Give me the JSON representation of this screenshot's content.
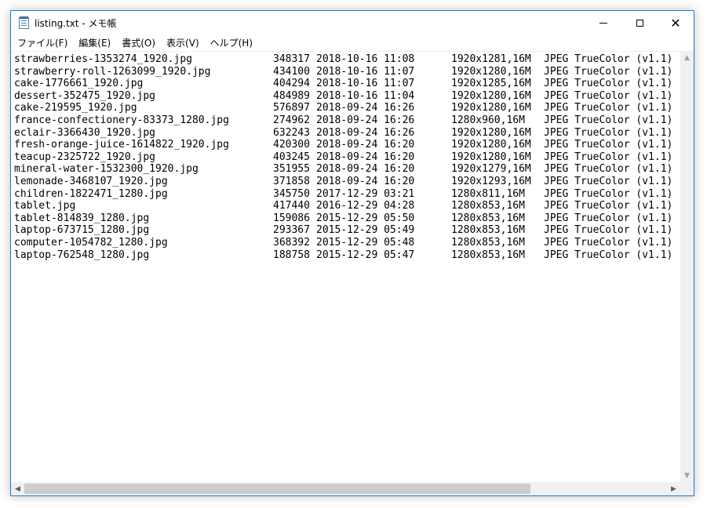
{
  "window": {
    "title": "listing.txt - メモ帳",
    "minimize_icon": "minimize-icon",
    "maximize_icon": "maximize-icon",
    "close_icon": "close-icon",
    "close_glyph": "✕"
  },
  "menu": [
    "ファイル(F)",
    "編集(E)",
    "書式(O)",
    "表示(V)",
    "ヘルプ(H)"
  ],
  "lines": [
    {
      "name": "strawberries-1353274_1920.jpg",
      "size": "348317",
      "date": "2018-10-16 11:08",
      "dim": "1920x1281,16M",
      "type": "JPEG TrueColor (v1.1)"
    },
    {
      "name": "strawberry-roll-1263099_1920.jpg",
      "size": "434100",
      "date": "2018-10-16 11:07",
      "dim": "1920x1280,16M",
      "type": "JPEG TrueColor (v1.1)"
    },
    {
      "name": "cake-1776661_1920.jpg",
      "size": "404294",
      "date": "2018-10-16 11:07",
      "dim": "1920x1285,16M",
      "type": "JPEG TrueColor (v1.1)"
    },
    {
      "name": "dessert-352475_1920.jpg",
      "size": "484989",
      "date": "2018-10-16 11:04",
      "dim": "1920x1280,16M",
      "type": "JPEG TrueColor (v1.1)"
    },
    {
      "name": "cake-219595_1920.jpg",
      "size": "576897",
      "date": "2018-09-24 16:26",
      "dim": "1920x1280,16M",
      "type": "JPEG TrueColor (v1.1)"
    },
    {
      "name": "france-confectionery-83373_1280.jpg",
      "size": "274962",
      "date": "2018-09-24 16:26",
      "dim": "1280x960,16M",
      "type": "JPEG TrueColor (v1.1)"
    },
    {
      "name": "eclair-3366430_1920.jpg",
      "size": "632243",
      "date": "2018-09-24 16:26",
      "dim": "1920x1280,16M",
      "type": "JPEG TrueColor (v1.1)"
    },
    {
      "name": "fresh-orange-juice-1614822_1920.jpg",
      "size": "420300",
      "date": "2018-09-24 16:20",
      "dim": "1920x1280,16M",
      "type": "JPEG TrueColor (v1.1)"
    },
    {
      "name": "teacup-2325722_1920.jpg",
      "size": "403245",
      "date": "2018-09-24 16:20",
      "dim": "1920x1280,16M",
      "type": "JPEG TrueColor (v1.1)"
    },
    {
      "name": "mineral-water-1532300_1920.jpg",
      "size": "351955",
      "date": "2018-09-24 16:20",
      "dim": "1920x1279,16M",
      "type": "JPEG TrueColor (v1.1)"
    },
    {
      "name": "lemonade-3468107_1920.jpg",
      "size": "371858",
      "date": "2018-09-24 16:20",
      "dim": "1920x1293,16M",
      "type": "JPEG TrueColor (v1.1)"
    },
    {
      "name": "children-1822471_1280.jpg",
      "size": "345750",
      "date": "2017-12-29 03:21",
      "dim": "1280x811,16M",
      "type": "JPEG TrueColor (v1.1)"
    },
    {
      "name": "tablet.jpg",
      "size": "417440",
      "date": "2016-12-29 04:28",
      "dim": "1280x853,16M",
      "type": "JPEG TrueColor (v1.1)"
    },
    {
      "name": "tablet-814839_1280.jpg",
      "size": "159086",
      "date": "2015-12-29 05:50",
      "dim": "1280x853,16M",
      "type": "JPEG TrueColor (v1.1)"
    },
    {
      "name": "laptop-673715_1280.jpg",
      "size": "293367",
      "date": "2015-12-29 05:49",
      "dim": "1280x853,16M",
      "type": "JPEG TrueColor (v1.1)"
    },
    {
      "name": "computer-1054782_1280.jpg",
      "size": "368392",
      "date": "2015-12-29 05:48",
      "dim": "1280x853,16M",
      "type": "JPEG TrueColor (v1.1)"
    },
    {
      "name": "laptop-762548_1280.jpg",
      "size": "188758",
      "date": "2015-12-29 05:47",
      "dim": "1280x853,16M",
      "type": "JPEG TrueColor (v1.1)"
    }
  ],
  "scrollbars": {
    "up_glyph": "▲",
    "down_glyph": "▼",
    "left_glyph": "◀",
    "right_glyph": "▶"
  }
}
